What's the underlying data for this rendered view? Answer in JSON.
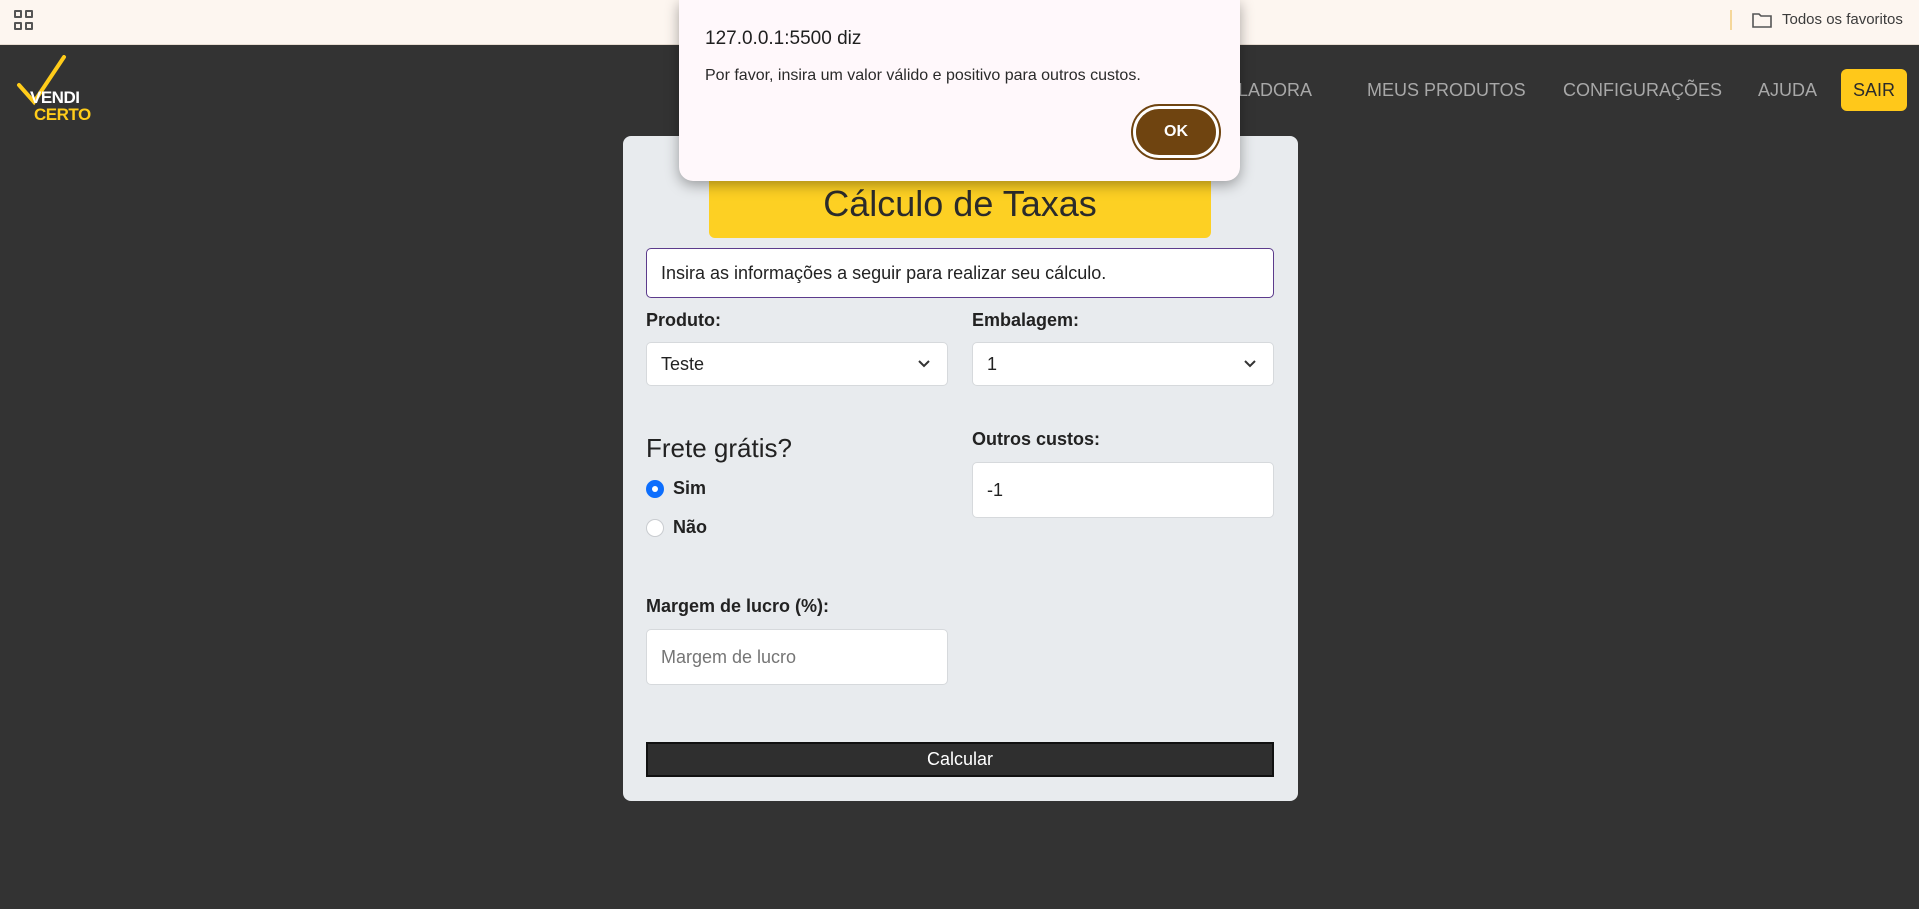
{
  "browser": {
    "apps_icon": "apps-grid-icon",
    "bookmarks_folder": "Todos os favoritos"
  },
  "nav": {
    "logo_line1": "VENDI",
    "logo_line2": "CERTO",
    "items": [
      {
        "label": "CALCULADORA"
      },
      {
        "label": "MEUS PRODUTOS"
      },
      {
        "label": "CONFIGURAÇÕES"
      },
      {
        "label": "AJUDA"
      }
    ],
    "logout": "SAIR"
  },
  "form": {
    "title": "Cálculo de Taxas",
    "instructions": "Insira as informações a seguir para realizar seu cálculo.",
    "produto_label": "Produto:",
    "produto_value": "Teste",
    "embalagem_label": "Embalagem:",
    "embalagem_value": "1",
    "frete_title": "Frete grátis?",
    "frete_options": [
      {
        "label": "Sim",
        "checked": true
      },
      {
        "label": "Não",
        "checked": false
      }
    ],
    "outros_label": "Outros custos:",
    "outros_value": "-1",
    "margem_label": "Margem de lucro (%):",
    "margem_placeholder": "Margem de lucro",
    "submit": "Calcular"
  },
  "dialog": {
    "title": "127.0.0.1:5500 diz",
    "message": "Por favor, insira um valor válido e positivo para outros custos.",
    "ok": "OK"
  },
  "colors": {
    "page_bg": "#333333",
    "accent_yellow": "#fdd023",
    "ok_button": "#6f4410",
    "radio_checked": "#0d6efd"
  }
}
